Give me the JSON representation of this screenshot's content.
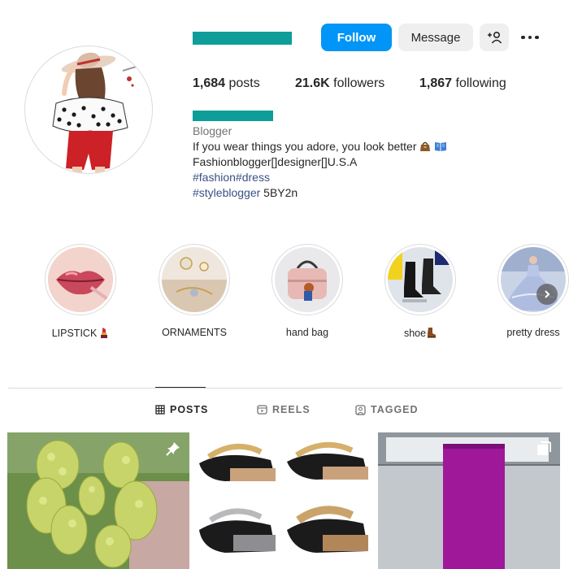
{
  "profile": {
    "category": "Blogger",
    "bio_line1": "If you wear things you adore, you look better",
    "bio_line2": "Fashionblogger[]designer[]U.S.A",
    "bio_tags_line": "#fashion#dress",
    "bio_tag_4": "#styleblogger",
    "bio_line4_rest": " 5BY2n"
  },
  "actions": {
    "follow_label": "Follow",
    "message_label": "Message"
  },
  "stats": {
    "posts_count": "1,684",
    "posts_label": " posts",
    "followers_count": "21.6K",
    "followers_label": " followers",
    "following_count": "1,867",
    "following_label": " following"
  },
  "highlights": [
    {
      "label": "LIPSTICK"
    },
    {
      "label": "ORNAMENTS"
    },
    {
      "label": "hand bag"
    },
    {
      "label": "shoe"
    },
    {
      "label": "pretty dress"
    }
  ],
  "tabs": {
    "posts": "POSTS",
    "reels": "REELS",
    "tagged": "TAGGED"
  },
  "colors": {
    "follow": "#0095f6",
    "redaction": "#0f9d9a",
    "link": "#385185"
  },
  "icons": {
    "add_user": "person-plus-icon",
    "more": "more-horizontal-icon",
    "posts_tab": "grid-icon",
    "reels_tab": "reels-icon",
    "tagged_tab": "tagged-person-icon",
    "pinned": "pin-icon",
    "multi": "carousel-icon",
    "next": "chevron-right-icon"
  }
}
